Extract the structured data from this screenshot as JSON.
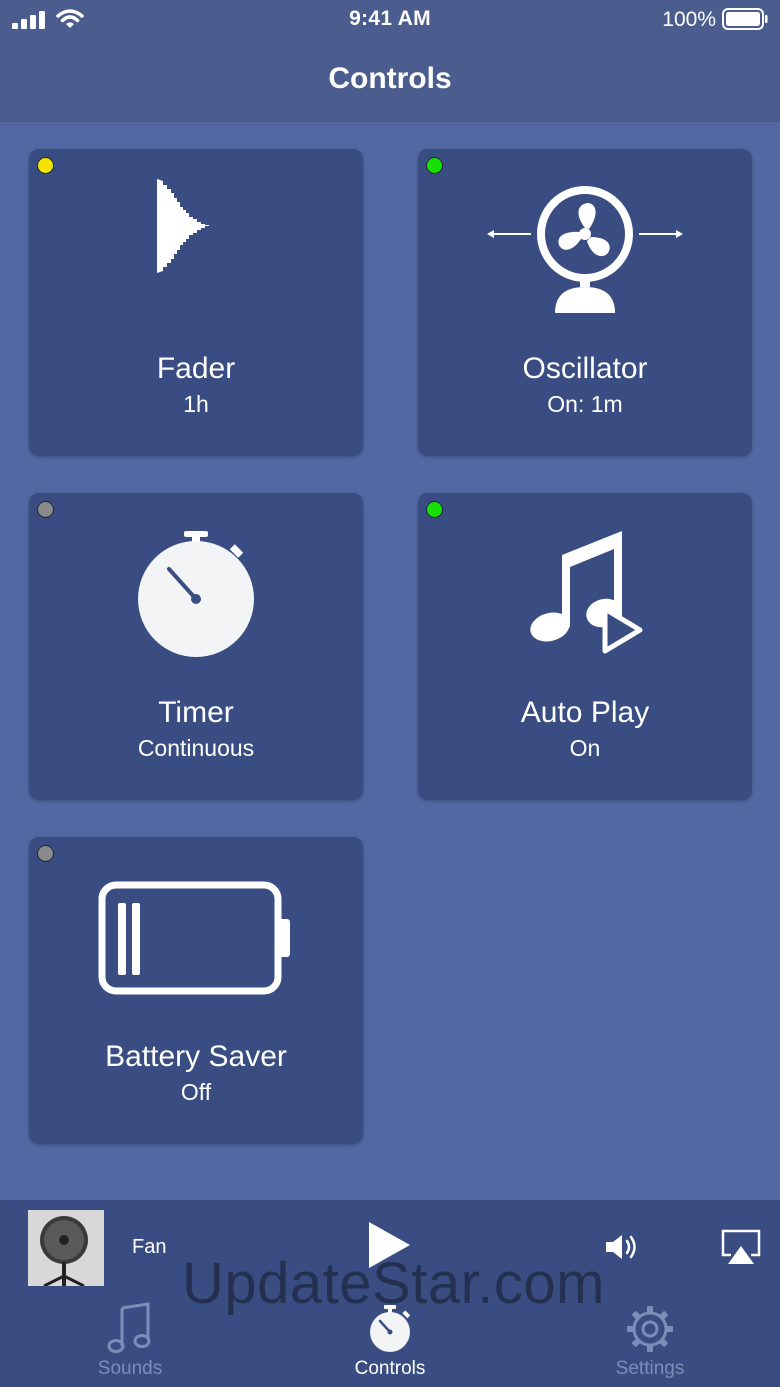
{
  "status_bar": {
    "time": "9:41 AM",
    "battery_percent": "100%"
  },
  "nav": {
    "title": "Controls"
  },
  "tiles": [
    {
      "label": "Fader",
      "value": "1h",
      "indicator_color": "#f5e400",
      "icon": "fader-icon"
    },
    {
      "label": "Oscillator",
      "value": "On: 1m",
      "indicator_color": "#16e000",
      "icon": "fan-oscillate-icon"
    },
    {
      "label": "Timer",
      "value": "Continuous",
      "indicator_color": "#8a8a8a",
      "icon": "stopwatch-icon"
    },
    {
      "label": "Auto Play",
      "value": "On",
      "indicator_color": "#16e000",
      "icon": "music-play-icon"
    },
    {
      "label": "Battery Saver",
      "value": "Off",
      "indicator_color": "#8a8a8a",
      "icon": "battery-icon"
    }
  ],
  "player": {
    "track_name": "Fan",
    "thumbnail": "fan-thumbnail",
    "watermark": "UpdateStar.com"
  },
  "tabs": [
    {
      "label": "Sounds",
      "icon": "music-note-icon",
      "active": false
    },
    {
      "label": "Controls",
      "icon": "stopwatch-icon",
      "active": true
    },
    {
      "label": "Settings",
      "icon": "gear-icon",
      "active": false
    }
  ],
  "colors": {
    "background": "#5368a2",
    "bar": "#4b5d8e",
    "tile": "#394d82",
    "active_tab": "#ffffff",
    "inactive_tab": "#7b8db8"
  }
}
